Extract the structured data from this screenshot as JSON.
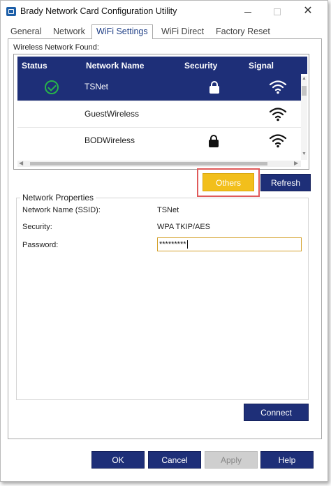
{
  "window": {
    "title": "Brady Network Card Configuration Utility"
  },
  "tabs": [
    {
      "label": "General",
      "active": false
    },
    {
      "label": "Network",
      "active": false
    },
    {
      "label": "WiFi Settings",
      "active": true
    },
    {
      "label": "WiFi Direct",
      "active": false
    },
    {
      "label": "Factory Reset",
      "active": false
    }
  ],
  "wireless": {
    "found_label": "Wireless Network Found:",
    "columns": [
      "Status",
      "Network Name",
      "Security",
      "Signal"
    ],
    "networks": [
      {
        "name": "TSNet",
        "connected": true,
        "secured": true,
        "signal_icon": "wifi-full-icon",
        "selected": true
      },
      {
        "name": "GuestWireless",
        "connected": false,
        "secured": false,
        "signal_icon": "wifi-full-icon",
        "selected": false
      },
      {
        "name": "BODWireless",
        "connected": false,
        "secured": true,
        "signal_icon": "wifi-full-icon",
        "selected": false
      }
    ]
  },
  "buttons": {
    "others": "Others",
    "refresh": "Refresh",
    "connect": "Connect",
    "ok": "OK",
    "cancel": "Cancel",
    "apply": "Apply",
    "help": "Help"
  },
  "properties": {
    "title": "Network Properties",
    "ssid_label": "Network Name (SSID):",
    "ssid_value": "TSNet",
    "security_label": "Security:",
    "security_value": "WPA TKIP/AES",
    "password_label": "Password:",
    "password_value": "*********"
  },
  "colors": {
    "accent": "#1e2f78",
    "highlight_button": "#f2bf1b",
    "annotation_box": "#e05a5a",
    "connected_check": "#27b34a"
  }
}
